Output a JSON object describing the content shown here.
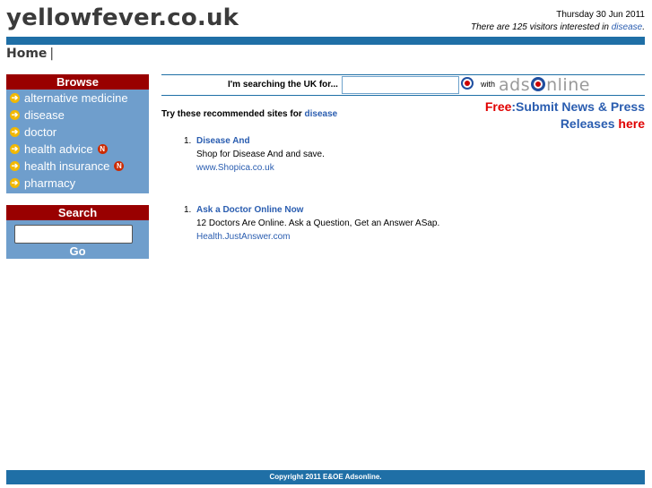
{
  "header": {
    "site_title": "yellowfever.co.uk",
    "date": "Thursday 30 Jun 2011",
    "visitors_prefix": "There are 125 visitors interested in ",
    "visitors_topic": "disease",
    "visitors_suffix": "."
  },
  "breadcrumb": {
    "home": "Home",
    "separator": "|"
  },
  "browse": {
    "title": "Browse",
    "items": [
      {
        "label": "alternative medicine",
        "new": false
      },
      {
        "label": "disease",
        "new": false
      },
      {
        "label": "doctor",
        "new": false
      },
      {
        "label": "health advice",
        "new": true,
        "badge": "N"
      },
      {
        "label": "health insurance",
        "new": true,
        "badge": "N"
      },
      {
        "label": "pharmacy",
        "new": false
      }
    ]
  },
  "search_panel": {
    "title": "Search",
    "input_value": "",
    "go_label": "Go"
  },
  "search_strip": {
    "label": "I'm searching the UK for...",
    "input_value": "",
    "with_label": "with",
    "logo_pre": "ads",
    "logo_post": "nline"
  },
  "promo": {
    "free": "Free",
    "line1_rest": ":Submit News & Press",
    "line2": "Releases ",
    "here": "here"
  },
  "recommend": {
    "prefix": "Try these recommended sites for ",
    "topic": "disease"
  },
  "results": [
    {
      "num": "1.",
      "title": "Disease And",
      "desc": "Shop for Disease And and save.",
      "url": "www.Shopica.co.uk"
    },
    {
      "num": "1.",
      "title": "Ask a Doctor Online Now",
      "desc": "12 Doctors Are Online. Ask a Question, Get an Answer ASap.",
      "url": "Health.JustAnswer.com"
    }
  ],
  "footer": {
    "copyright": "Copyright 2011 E&OE Adsonline."
  },
  "colors": {
    "bar_blue": "#1f6fa6",
    "panel_blue": "#6f9ecc",
    "panel_header_red": "#990000",
    "link_blue": "#2a5db0",
    "accent_red": "#e00000"
  },
  "icons": {
    "browse_bullet": "arrow-right-icon",
    "new_badge": "new-badge-icon",
    "logo_mark": "target-icon"
  }
}
